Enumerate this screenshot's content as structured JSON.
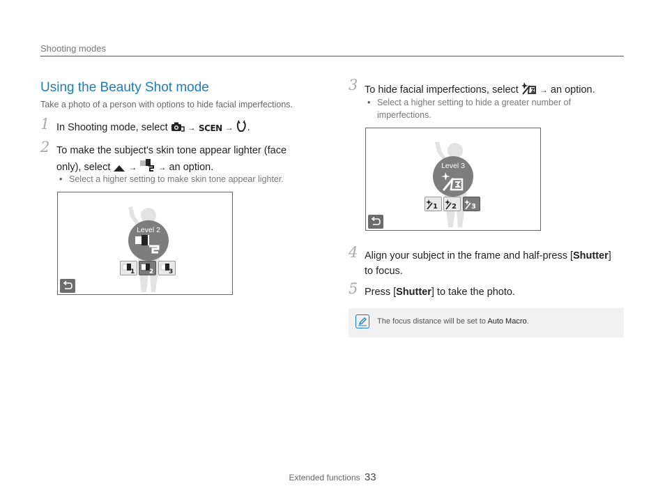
{
  "header": {
    "running_head": "Shooting modes"
  },
  "section": {
    "title": "Using the Beauty Shot mode",
    "subtitle": "Take a photo of a person with options to hide facial imperfections."
  },
  "steps": [
    {
      "num": "1",
      "text_before": "In Shooting mode, select",
      "arrow": "→",
      "end": "."
    },
    {
      "num": "2",
      "line1": "To make the subject's skin tone appear lighter (face",
      "line2_before": "only), select",
      "line2_after": "an option.",
      "arrow": "→",
      "bullet": "Select a higher setting to make skin tone appear lighter."
    },
    {
      "num": "3",
      "text_before": "To hide facial imperfections, select",
      "text_after": "an option.",
      "arrow": "→",
      "bullet_line1": "Select a higher setting to hide a greater number of",
      "bullet_line2": "imperfections."
    },
    {
      "num": "4",
      "line1_before": "Align your subject in the frame and half-press [",
      "line1_bold": "Shutter",
      "line1_after": "]",
      "line2": "to focus."
    },
    {
      "num": "5",
      "text_before": "Press [",
      "text_bold": "Shutter",
      "text_after": "] to take the photo."
    }
  ],
  "screen_skin": {
    "level_label": "Level 2",
    "options": [
      "1",
      "2",
      "3"
    ],
    "selected_index": 1
  },
  "screen_face": {
    "level_label": "Level 3",
    "options": [
      "1",
      "2",
      "3"
    ],
    "selected_index": 2
  },
  "note": {
    "text_before": "The focus distance will be set to",
    "text_bold": "Auto Macro",
    "text_after": "."
  },
  "footer": {
    "section": "Extended functions",
    "page": "33"
  },
  "colors": {
    "accent": "#1b7cc0",
    "step_number": "#aaaaaa"
  },
  "icons": [
    "camera-mode-icon",
    "scene-icon",
    "beauty-shot-icon",
    "up-arrow-icon",
    "skin-tone-icon",
    "face-retouch-icon",
    "back-icon",
    "note-pencil-icon"
  ]
}
